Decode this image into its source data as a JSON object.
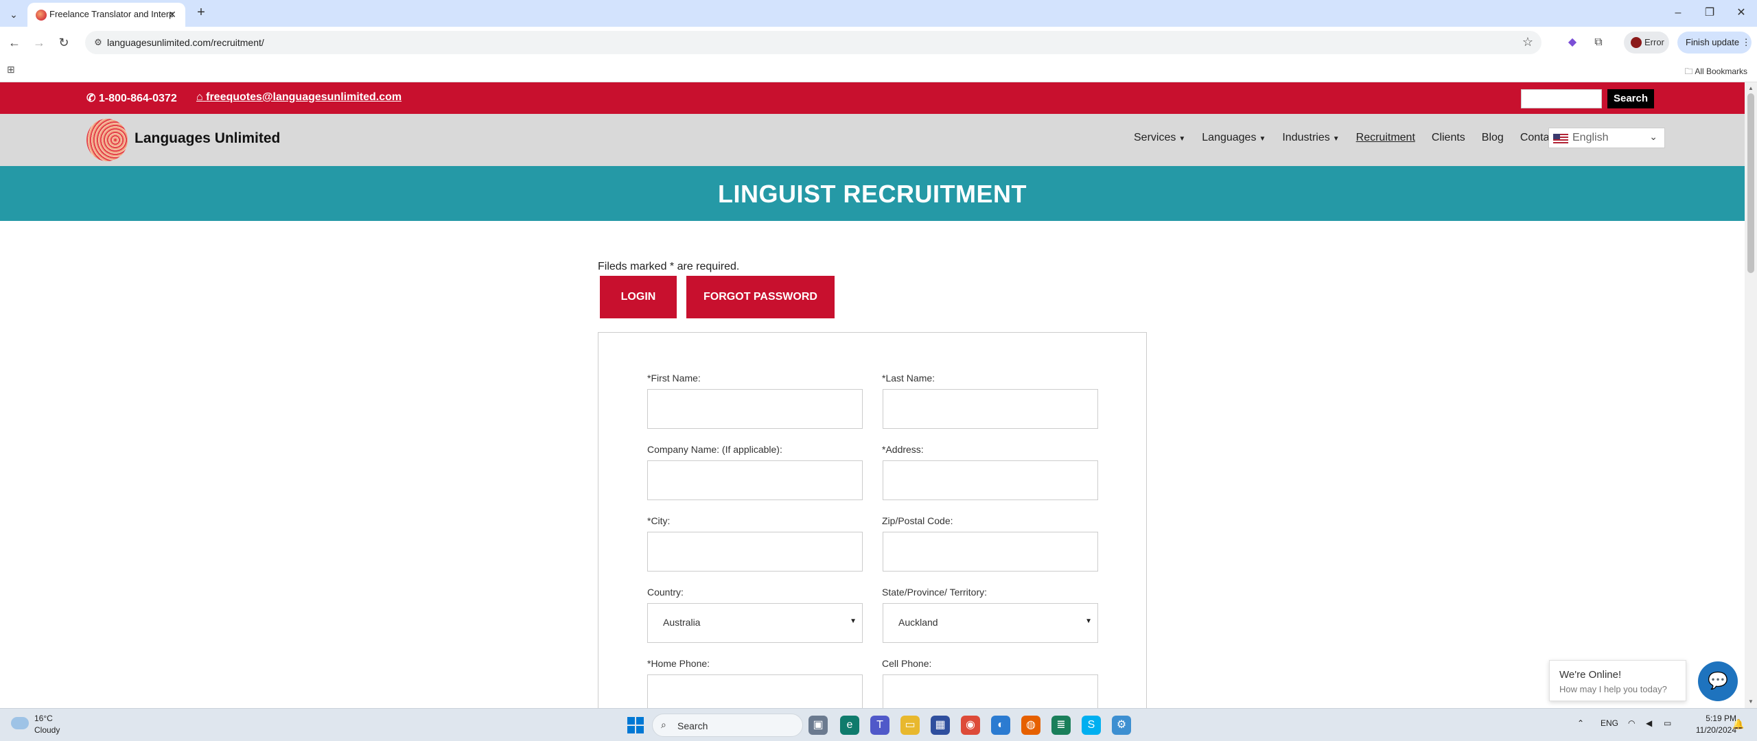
{
  "browser": {
    "tab_title": "Freelance Translator and Interpreter",
    "url": "languagesunlimited.com/recruitment/",
    "error_label": "Error",
    "finish_update_label": "Finish update",
    "all_bookmarks_label": "All Bookmarks"
  },
  "site": {
    "phone": "1-800-864-0372",
    "email": "freequotes@languagesunlimited.com",
    "search_button": "Search",
    "logo_text": "Languages Unlimited",
    "nav": [
      {
        "label": "Services",
        "dropdown": true
      },
      {
        "label": "Languages",
        "dropdown": true
      },
      {
        "label": "Industries",
        "dropdown": true
      },
      {
        "label": "Recruitment",
        "dropdown": false
      },
      {
        "label": "Clients",
        "dropdown": false
      },
      {
        "label": "Blog",
        "dropdown": false
      },
      {
        "label": "Contact",
        "dropdown": false
      }
    ],
    "language_selector": "English",
    "banner_title": "LINGUIST RECRUITMENT"
  },
  "form": {
    "required_note": "Fileds marked * are required.",
    "login_button": "LOGIN",
    "forgot_password_button": "FORGOT PASSWORD",
    "fields": {
      "first_name": "*First Name:",
      "last_name": "*Last Name:",
      "company_name": "Company Name: (If applicable):",
      "address": "*Address:",
      "city": "*City:",
      "zip": "Zip/Postal Code:",
      "country": "Country:",
      "state": "State/Province/ Territory:",
      "home_phone": "*Home Phone:",
      "cell_phone": "Cell Phone:"
    },
    "country_value": "Australia",
    "state_value": "Auckland"
  },
  "chat": {
    "title": "We're Online!",
    "subtitle": "How may I help you today?"
  },
  "taskbar": {
    "temperature": "16°C",
    "weather": "Cloudy",
    "search_label": "Search",
    "language": "ENG",
    "time": "5:19 PM",
    "date": "11/20/2024"
  }
}
